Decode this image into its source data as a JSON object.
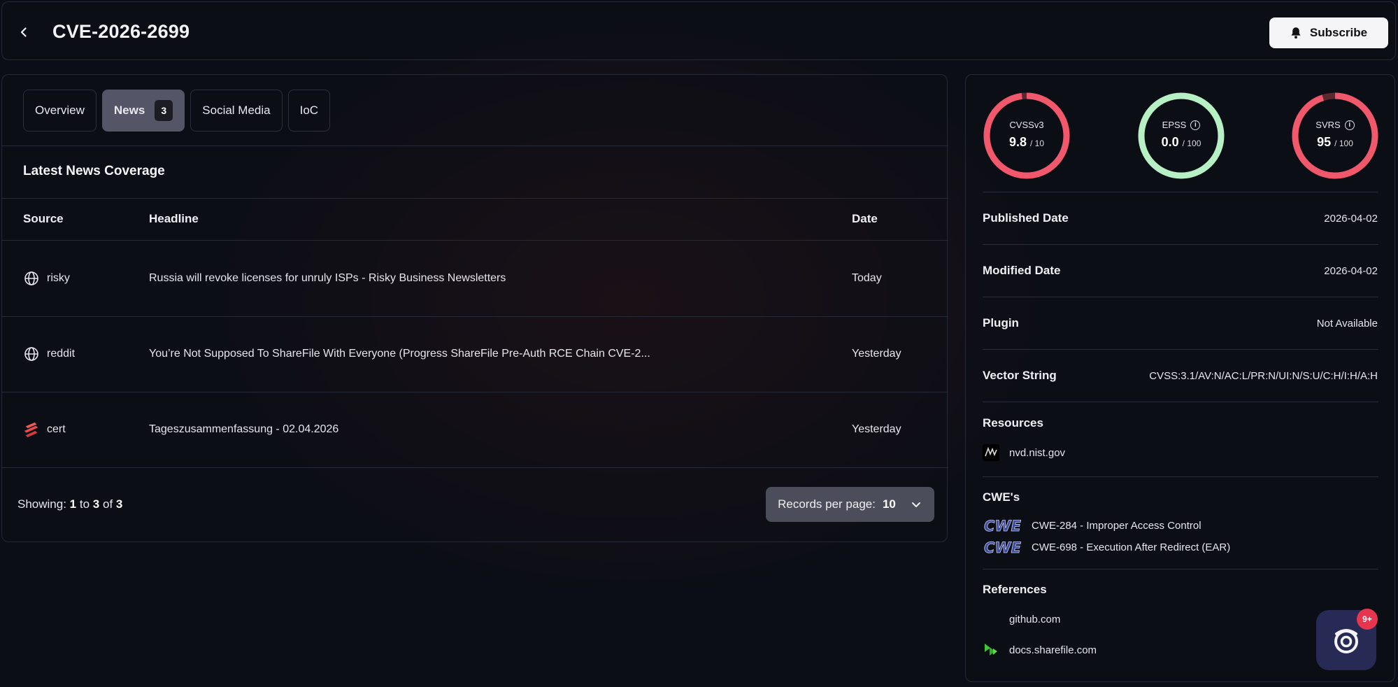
{
  "header": {
    "title": "CVE-2026-2699",
    "subscribe_label": "Subscribe"
  },
  "tabs": [
    {
      "label": "Overview",
      "active": false
    },
    {
      "label": "News",
      "active": true,
      "badge": "3"
    },
    {
      "label": "Social Media",
      "active": false
    },
    {
      "label": "IoC",
      "active": false
    }
  ],
  "news": {
    "heading": "Latest News Coverage",
    "columns": [
      "Source",
      "Headline",
      "Date"
    ],
    "rows": [
      {
        "source": "risky",
        "icon": "globe-icon",
        "headline": "Russia will revoke licenses for unruly ISPs - Risky Business Newsletters",
        "date": "Today"
      },
      {
        "source": "reddit",
        "icon": "globe-icon",
        "headline": "You’re Not Supposed To ShareFile With Everyone (Progress ShareFile Pre-Auth RCE Chain CVE-2...",
        "date": "Yesterday"
      },
      {
        "source": "cert",
        "icon": "cert-logo-icon",
        "headline": "Tageszusammenfassung - 02.04.2026",
        "date": "Yesterday"
      }
    ],
    "pagination": {
      "showing_prefix": "Showing:",
      "from": "1",
      "to_word": "to",
      "to": "3",
      "of_word": "of",
      "total": "3",
      "records_label": "Records per page:",
      "records_value": "10"
    }
  },
  "scores": [
    {
      "name": "CVSSv3",
      "value": "9.8",
      "max": "/ 10",
      "fraction": 0.98,
      "color": "#f2586b",
      "info": false
    },
    {
      "name": "EPSS",
      "value": "0.0",
      "max": "/ 100",
      "fraction": 0.0,
      "color": "#b7f0c5",
      "info": true
    },
    {
      "name": "SVRS",
      "value": "95",
      "max": "/ 100",
      "fraction": 0.95,
      "color": "#f2586b",
      "info": true
    }
  ],
  "details": {
    "published_label": "Published Date",
    "published_value": "2026-04-02",
    "modified_label": "Modified Date",
    "modified_value": "2026-04-02",
    "plugin_label": "Plugin",
    "plugin_value": "Not Available",
    "vector_label": "Vector String",
    "vector_value": "CVSS:3.1/AV:N/AC:L/PR:N/UI:N/S:U/C:H/I:H/A:H"
  },
  "resources": {
    "title": "Resources",
    "items": [
      {
        "label": "nvd.nist.gov",
        "icon": "nvd-logo-icon"
      }
    ]
  },
  "cwes": {
    "title": "CWE's",
    "items": [
      {
        "label": "CWE-284 - Improper Access Control",
        "icon": "cwe-logo-icon"
      },
      {
        "label": "CWE-698 - Execution After Redirect (EAR)",
        "icon": "cwe-logo-icon"
      }
    ]
  },
  "references": {
    "title": "References",
    "items": [
      {
        "label": "github.com",
        "icon": "github-icon"
      },
      {
        "label": "docs.sharefile.com",
        "icon": "sharefile-logo-icon"
      }
    ]
  },
  "chat": {
    "badge": "9+"
  }
}
